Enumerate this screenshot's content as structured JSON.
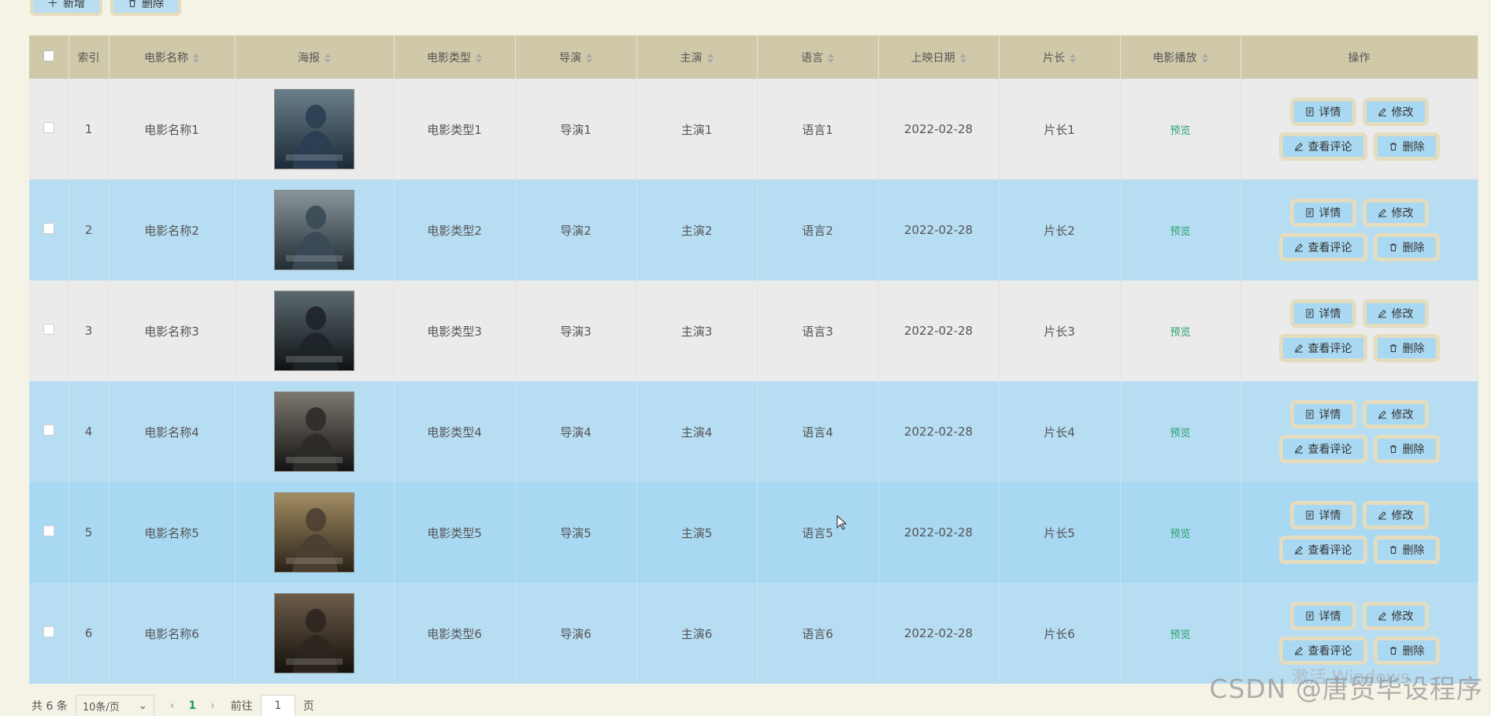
{
  "toolbar": {
    "add_label": "新增",
    "delete_label": "删除"
  },
  "table": {
    "headers": {
      "index": "索引",
      "name": "电影名称",
      "poster": "海报",
      "type": "电影类型",
      "director": "导演",
      "cast": "主演",
      "language": "语言",
      "date": "上映日期",
      "length": "片长",
      "play": "电影播放",
      "actions": "操作"
    },
    "actions": {
      "detail": "详情",
      "edit": "修改",
      "comments": "查看评论",
      "delete": "删除"
    },
    "rows": [
      {
        "index": "1",
        "name": "电影名称1",
        "type": "电影类型1",
        "director": "导演1",
        "cast": "主演1",
        "language": "语言1",
        "date": "2022-02-28",
        "length": "片长1",
        "play": "预览"
      },
      {
        "index": "2",
        "name": "电影名称2",
        "type": "电影类型2",
        "director": "导演2",
        "cast": "主演2",
        "language": "语言2",
        "date": "2022-02-28",
        "length": "片长2",
        "play": "预览"
      },
      {
        "index": "3",
        "name": "电影名称3",
        "type": "电影类型3",
        "director": "导演3",
        "cast": "主演3",
        "language": "语言3",
        "date": "2022-02-28",
        "length": "片长3",
        "play": "预览"
      },
      {
        "index": "4",
        "name": "电影名称4",
        "type": "电影类型4",
        "director": "导演4",
        "cast": "主演4",
        "language": "语言4",
        "date": "2022-02-28",
        "length": "片长4",
        "play": "预览"
      },
      {
        "index": "5",
        "name": "电影名称5",
        "type": "电影类型5",
        "director": "导演5",
        "cast": "主演5",
        "language": "语言5",
        "date": "2022-02-28",
        "length": "片长5",
        "play": "预览"
      },
      {
        "index": "6",
        "name": "电影名称6",
        "type": "电影类型6",
        "director": "导演6",
        "cast": "主演6",
        "language": "语言6",
        "date": "2022-02-28",
        "length": "片长6",
        "play": "预览"
      }
    ]
  },
  "pager": {
    "total": "共 6 条",
    "page_size": "10条/页",
    "current": "1",
    "goto_prefix": "前往",
    "goto_value": "1",
    "goto_suffix": "页"
  },
  "watermarks": {
    "windows": "激活 Windows",
    "csdn": "CSDN @唐贸毕设程序"
  },
  "colors": {
    "header_bg": "#cfc9aa",
    "row_light": "#ebebeb",
    "row_blue": "#b7ddf3",
    "button_bg": "#a9d8f2",
    "button_border": "#e4dcbf",
    "preview_green": "#2aa06f"
  }
}
